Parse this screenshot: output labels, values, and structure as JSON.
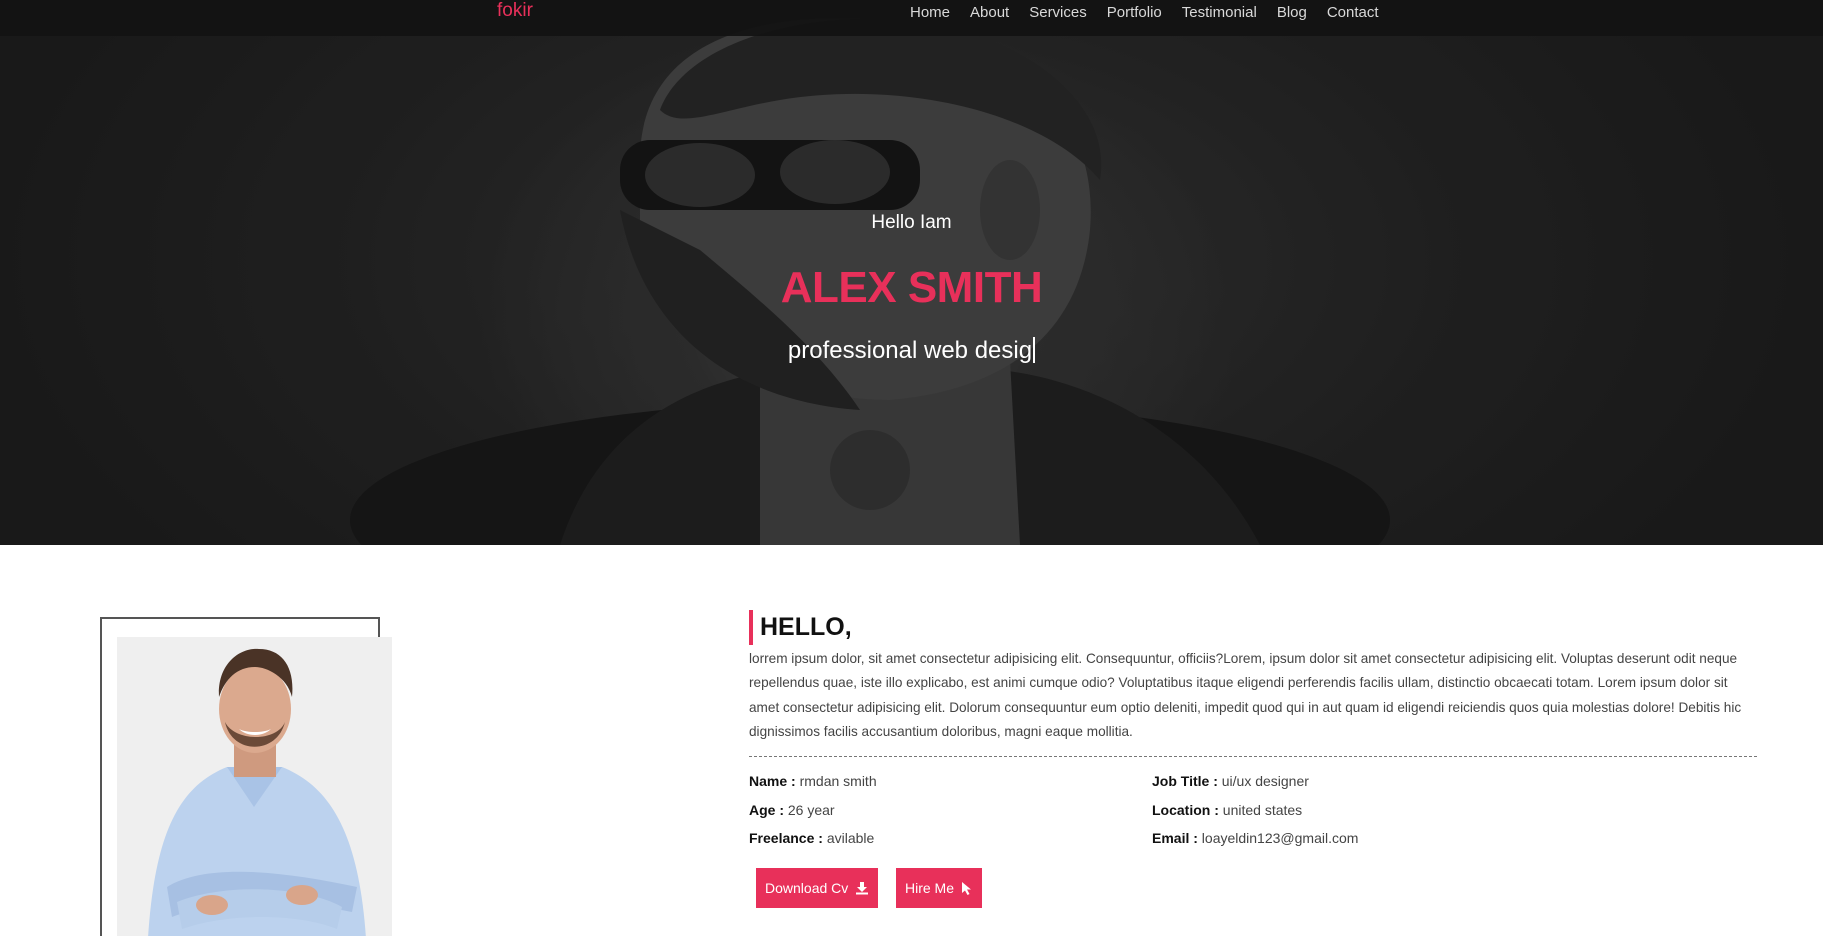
{
  "navbar": {
    "logo": "fokir",
    "links": [
      "Home",
      "About",
      "Services",
      "Portfolio",
      "Testimonial",
      "Blog",
      "Contact"
    ]
  },
  "hero": {
    "greeting": "Hello Iam",
    "name": "ALEX SMITH",
    "role": "professional web desig"
  },
  "about": {
    "title": "HELLO,",
    "paragraph": "lorrem ipsum dolor, sit amet consectetur adipisicing elit. Consequuntur, officiis?Lorem, ipsum dolor sit amet consectetur adipisicing elit. Voluptas deserunt odit neque repellendus quae, iste illo explicabo, est animi cumque odio? Voluptatibus itaque eligendi perferendis facilis ullam, distinctio obcaecati totam. Lorem ipsum dolor sit amet consectetur adipisicing elit. Dolorum consequuntur eum optio deleniti, impedit quod qui in aut quam id eligendi reiciendis quos quia molestias dolore! Debitis hic dignissimos facilis accusantium doloribus, magni eaque mollitia.",
    "info": {
      "name_label": "Name :",
      "name_value": "rmdan smith",
      "age_label": "Age :",
      "age_value": "26 year",
      "freelance_label": "Freelance :",
      "freelance_value": "avilable",
      "job_label": "Job Title :",
      "job_value": "ui/ux designer",
      "location_label": "Location :",
      "location_value": "united states",
      "email_label": "Email :",
      "email_value": "loayeldin123@gmail.com"
    },
    "buttons": {
      "download": "Download Cv",
      "hire": "Hire Me"
    }
  },
  "colors": {
    "accent": "#e8305a",
    "navbar": "#121212",
    "hero_bg": "#2a2a2a"
  },
  "icons": [
    "download-icon",
    "cursor-pointer-icon"
  ]
}
